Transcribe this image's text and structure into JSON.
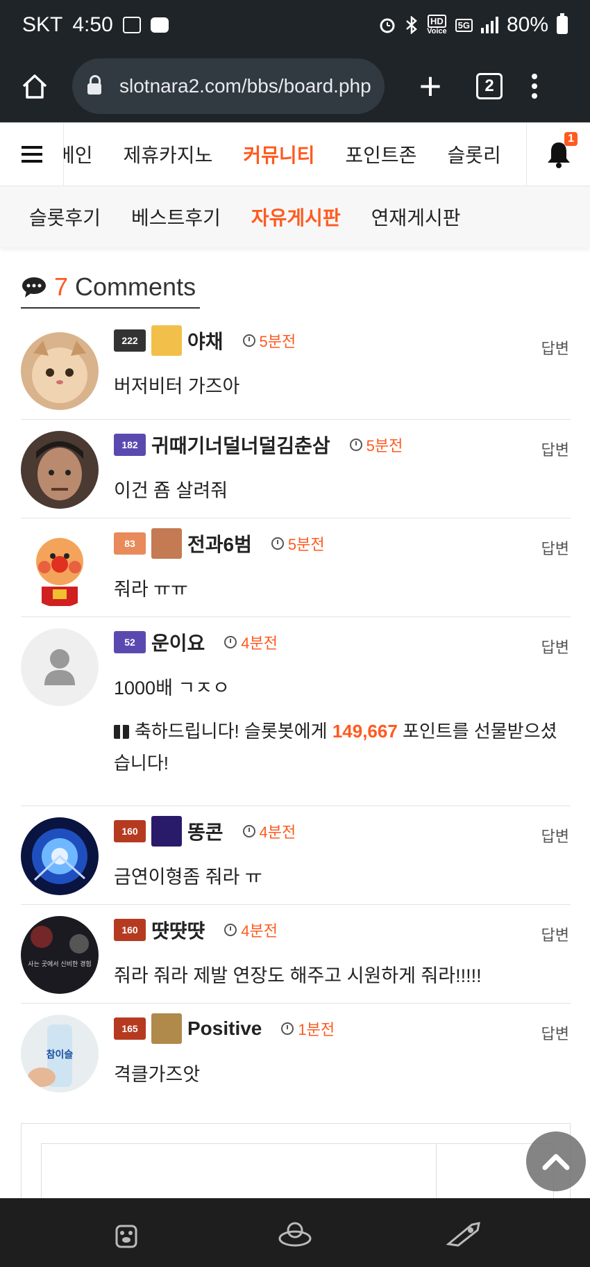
{
  "status_bar": {
    "carrier": "SKT",
    "time": "4:50",
    "hd_label": "HD",
    "voice_label": "Voice",
    "network": "5G",
    "battery": "80%"
  },
  "browser": {
    "url": "slotnara2.com/bbs/board.php",
    "tab_count": "2"
  },
  "main_nav": {
    "items": [
      "메인",
      "제휴카지노",
      "커뮤니티",
      "포인트존",
      "슬롯리"
    ],
    "active_index": 2,
    "notification_count": "1"
  },
  "sub_nav": {
    "items": [
      "슬롯후기",
      "베스트후기",
      "자유게시판",
      "연재게시판"
    ],
    "active_index": 2
  },
  "comments_header": {
    "count": "7",
    "label": "Comments"
  },
  "reply_label": "답변",
  "comments": [
    {
      "level": "222",
      "nick": "야채",
      "time": "5분전",
      "text": "버저비터 가즈아"
    },
    {
      "level": "182",
      "nick": "귀때기너덜너덜김춘삼",
      "time": "5분전",
      "text": "이건 죰 살려줘"
    },
    {
      "level": "83",
      "nick": "전과6범",
      "time": "5분전",
      "text": "줘라 ㅠㅠ"
    },
    {
      "level": "52",
      "nick": "운이요",
      "time": "4분전",
      "text": "1000배 ㄱㅈㅇ",
      "gift": {
        "prefix": "축하드립니다! 슬롯봇에게",
        "points": "149,667",
        "suffix": "포인트를 선물받으셨습니다!"
      }
    },
    {
      "level": "160",
      "nick": "똥콘",
      "time": "4분전",
      "text": "금연이형좀 줘라 ㅠ"
    },
    {
      "level": "160",
      "nick": "땻땻땻",
      "time": "4분전",
      "text": "줘라 줘라 제발 연장도 해주고 시원하게 줘라!!!!!"
    },
    {
      "level": "165",
      "nick": "Positive",
      "time": "1분전",
      "text": "격클가즈앗"
    }
  ],
  "avatar_text": {
    "avatar_6": "사는 곳에서 신비한 경험",
    "avatar_7": "참이슬"
  },
  "colors": {
    "accent": "#ff5a1f",
    "status_bg": "#1f2428",
    "bottom_bar": "#1e1e1e"
  }
}
